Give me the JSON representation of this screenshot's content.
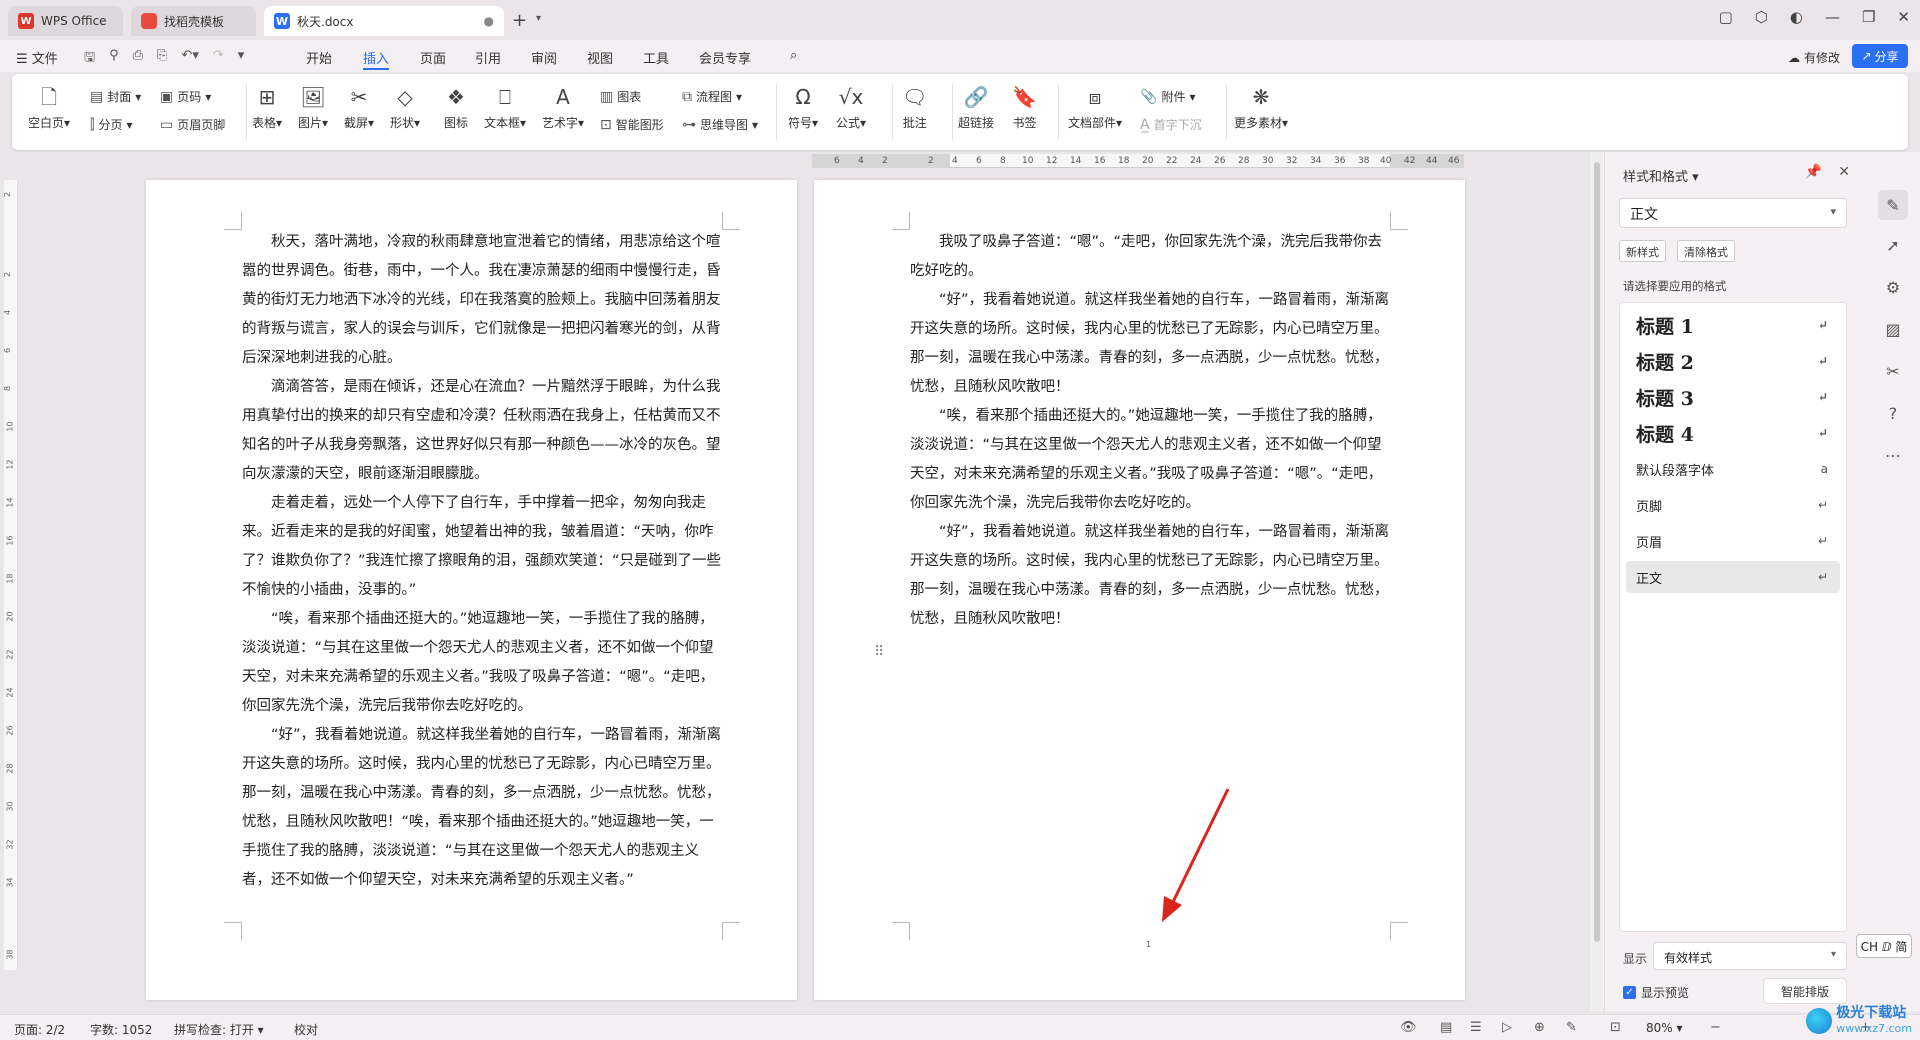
{
  "tabs": [
    {
      "label": "WPS Office"
    },
    {
      "label": "找稻壳模板"
    },
    {
      "label": "秋天.docx"
    }
  ],
  "menu": {
    "file": "文件",
    "items": [
      "开始",
      "插入",
      "页面",
      "引用",
      "审阅",
      "视图",
      "工具",
      "会员专享"
    ],
    "active": "插入",
    "modified": "有修改",
    "share": "分享"
  },
  "ribbon": {
    "blank_page": "空白页",
    "cover": "封面",
    "page_break": "分页",
    "page_number": "页码",
    "header_footer": "页眉页脚",
    "table": "表格",
    "picture": "图片",
    "screenshot": "截屏",
    "shape": "形状",
    "icon": "图标",
    "textbox": "文本框",
    "wordart": "艺术字",
    "chart": "图表",
    "smart_shape": "智能图形",
    "flowchart": "流程图",
    "mindmap": "思维导图",
    "symbol": "符号",
    "formula": "公式",
    "comment": "批注",
    "hyperlink": "超链接",
    "bookmark": "书签",
    "doc_parts": "文档部件",
    "attachment": "附件",
    "drop_cap": "首字下沉",
    "more_assets": "更多素材"
  },
  "ruler": {
    "h_numbers": [
      "6",
      "4",
      "2",
      "2",
      "4",
      "6",
      "8",
      "10",
      "12",
      "14",
      "16",
      "18",
      "20",
      "22",
      "24",
      "26",
      "28",
      "30",
      "32",
      "34",
      "36",
      "38",
      "40",
      "42",
      "44",
      "46"
    ],
    "v_numbers": [
      "2",
      "2",
      "4",
      "6",
      "8",
      "10",
      "12",
      "14",
      "16",
      "18",
      "20",
      "22",
      "24",
      "26",
      "28",
      "30",
      "32",
      "34",
      "38"
    ]
  },
  "page1": {
    "paragraphs": [
      "　　秋天，落叶满地，冷寂的秋雨肆意地宣泄着它的情绪，用悲凉给这个喧嚣的世界调色。街巷，雨中，一个人。我在凄凉萧瑟的细雨中慢慢行走，昏黄的街灯无力地洒下冰冷的光线，印在我落寞的脸颊上。我脑中回荡着朋友的背叛与谎言，家人的误会与训斥，它们就像是一把把闪着寒光的剑，从背后深深地刺进我的心脏。",
      "　　滴滴答答，是雨在倾诉，还是心在流血？一片黯然浮于眼眸，为什么我用真挚付出的换来的却只有空虚和冷漠？任秋雨洒在我身上，任枯黄而又不知名的叶子从我身旁飘落，这世界好似只有那一种颜色——冰冷的灰色。望向灰濛濛的天空，眼前逐渐泪眼朦胧。",
      "　　走着走着，远处一个人停下了自行车，手中撑着一把伞，匆匆向我走来。近看走来的是我的好闺蜜，她望着出神的我，皱着眉道：“天呐，你咋了？谁欺负你了？”我连忙擦了擦眼角的泪，强颜欢笑道：“只是碰到了一些不愉快的小插曲，没事的。”",
      "　　“唉，看来那个插曲还挺大的。”她逗趣地一笑，一手揽住了我的胳膊，淡淡说道：“与其在这里做一个怨天尤人的悲观主义者，还不如做一个仰望天空，对未来充满希望的乐观主义者。”我吸了吸鼻子答道：“嗯”。“走吧，你回家先洗个澡，洗完后我带你去吃好吃的。",
      "　　“好”，我看着她说道。就这样我坐着她的自行车，一路冒着雨，渐渐离开这失意的场所。这时候，我内心里的忧愁已了无踪影，内心已晴空万里。那一刻，温暖在我心中荡漾。青春的刻，多一点洒脱，少一点忧愁。忧愁，忧愁，且随秋风吹散吧！“唉，看来那个插曲还挺大的。”她逗趣地一笑，一手揽住了我的胳膊，淡淡说道：“与其在这里做一个怨天尤人的悲观主义者，还不如做一个仰望天空，对未来充满希望的乐观主义者。”"
    ]
  },
  "page2": {
    "paragraphs": [
      "　　我吸了吸鼻子答道：“嗯”。“走吧，你回家先洗个澡，洗完后我带你去吃好吃的。",
      "　　“好”，我看着她说道。就这样我坐着她的自行车，一路冒着雨，渐渐离开这失意的场所。这时候，我内心里的忧愁已了无踪影，内心已晴空万里。那一刻，温暖在我心中荡漾。青春的刻，多一点洒脱，少一点忧愁。忧愁，忧愁，且随秋风吹散吧！",
      "　　“唉，看来那个插曲还挺大的。”她逗趣地一笑，一手揽住了我的胳膊，淡淡说道：“与其在这里做一个怨天尤人的悲观主义者，还不如做一个仰望天空，对未来充满希望的乐观主义者。”我吸了吸鼻子答道：“嗯”。“走吧，你回家先洗个澡，洗完后我带你去吃好吃的。",
      "　　“好”，我看着她说道。就这样我坐着她的自行车，一路冒着雨，渐渐离开这失意的场所。这时候，我内心里的忧愁已了无踪影，内心已晴空万里。那一刻，温暖在我心中荡漾。青春的刻，多一点洒脱，少一点忧愁。忧愁，忧愁，且随秋风吹散吧！"
    ],
    "page_number": "1"
  },
  "panel": {
    "title": "样式和格式",
    "current_style": "正文",
    "new_style": "新样式",
    "clear_format": "清除格式",
    "choose_label": "请选择要应用的格式",
    "styles": [
      "标题 1",
      "标题 2",
      "标题 3",
      "标题 4",
      "默认段落字体",
      "页脚",
      "页眉",
      "正文"
    ],
    "show_label": "显示",
    "show_value": "有效样式",
    "preview_label": "显示预览",
    "smart_layout": "智能排版"
  },
  "ime": "CH ⅅ 简",
  "status": {
    "page": "页面: 2/2",
    "words": "字数: 1052",
    "spellcheck": "拼写检查: 打开",
    "proofread": "校对",
    "zoom": "80%"
  },
  "watermark": {
    "line1": "极光下载站",
    "line2": "www.xz7.com"
  },
  "colors": {
    "accent": "#2b6ff2",
    "arrow": "#d9251c"
  }
}
